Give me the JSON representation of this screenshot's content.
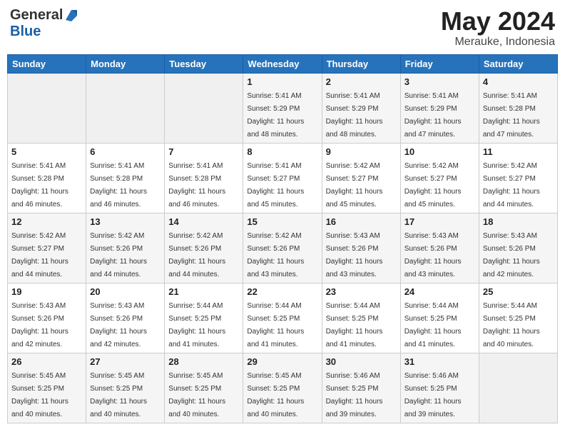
{
  "header": {
    "logo_general": "General",
    "logo_blue": "Blue",
    "month": "May 2024",
    "location": "Merauke, Indonesia"
  },
  "days_of_week": [
    "Sunday",
    "Monday",
    "Tuesday",
    "Wednesday",
    "Thursday",
    "Friday",
    "Saturday"
  ],
  "weeks": [
    [
      {
        "day": "",
        "info": ""
      },
      {
        "day": "",
        "info": ""
      },
      {
        "day": "",
        "info": ""
      },
      {
        "day": "1",
        "info": "Sunrise: 5:41 AM\nSunset: 5:29 PM\nDaylight: 11 hours\nand 48 minutes."
      },
      {
        "day": "2",
        "info": "Sunrise: 5:41 AM\nSunset: 5:29 PM\nDaylight: 11 hours\nand 48 minutes."
      },
      {
        "day": "3",
        "info": "Sunrise: 5:41 AM\nSunset: 5:29 PM\nDaylight: 11 hours\nand 47 minutes."
      },
      {
        "day": "4",
        "info": "Sunrise: 5:41 AM\nSunset: 5:28 PM\nDaylight: 11 hours\nand 47 minutes."
      }
    ],
    [
      {
        "day": "5",
        "info": "Sunrise: 5:41 AM\nSunset: 5:28 PM\nDaylight: 11 hours\nand 46 minutes."
      },
      {
        "day": "6",
        "info": "Sunrise: 5:41 AM\nSunset: 5:28 PM\nDaylight: 11 hours\nand 46 minutes."
      },
      {
        "day": "7",
        "info": "Sunrise: 5:41 AM\nSunset: 5:28 PM\nDaylight: 11 hours\nand 46 minutes."
      },
      {
        "day": "8",
        "info": "Sunrise: 5:41 AM\nSunset: 5:27 PM\nDaylight: 11 hours\nand 45 minutes."
      },
      {
        "day": "9",
        "info": "Sunrise: 5:42 AM\nSunset: 5:27 PM\nDaylight: 11 hours\nand 45 minutes."
      },
      {
        "day": "10",
        "info": "Sunrise: 5:42 AM\nSunset: 5:27 PM\nDaylight: 11 hours\nand 45 minutes."
      },
      {
        "day": "11",
        "info": "Sunrise: 5:42 AM\nSunset: 5:27 PM\nDaylight: 11 hours\nand 44 minutes."
      }
    ],
    [
      {
        "day": "12",
        "info": "Sunrise: 5:42 AM\nSunset: 5:27 PM\nDaylight: 11 hours\nand 44 minutes."
      },
      {
        "day": "13",
        "info": "Sunrise: 5:42 AM\nSunset: 5:26 PM\nDaylight: 11 hours\nand 44 minutes."
      },
      {
        "day": "14",
        "info": "Sunrise: 5:42 AM\nSunset: 5:26 PM\nDaylight: 11 hours\nand 44 minutes."
      },
      {
        "day": "15",
        "info": "Sunrise: 5:42 AM\nSunset: 5:26 PM\nDaylight: 11 hours\nand 43 minutes."
      },
      {
        "day": "16",
        "info": "Sunrise: 5:43 AM\nSunset: 5:26 PM\nDaylight: 11 hours\nand 43 minutes."
      },
      {
        "day": "17",
        "info": "Sunrise: 5:43 AM\nSunset: 5:26 PM\nDaylight: 11 hours\nand 43 minutes."
      },
      {
        "day": "18",
        "info": "Sunrise: 5:43 AM\nSunset: 5:26 PM\nDaylight: 11 hours\nand 42 minutes."
      }
    ],
    [
      {
        "day": "19",
        "info": "Sunrise: 5:43 AM\nSunset: 5:26 PM\nDaylight: 11 hours\nand 42 minutes."
      },
      {
        "day": "20",
        "info": "Sunrise: 5:43 AM\nSunset: 5:26 PM\nDaylight: 11 hours\nand 42 minutes."
      },
      {
        "day": "21",
        "info": "Sunrise: 5:44 AM\nSunset: 5:25 PM\nDaylight: 11 hours\nand 41 minutes."
      },
      {
        "day": "22",
        "info": "Sunrise: 5:44 AM\nSunset: 5:25 PM\nDaylight: 11 hours\nand 41 minutes."
      },
      {
        "day": "23",
        "info": "Sunrise: 5:44 AM\nSunset: 5:25 PM\nDaylight: 11 hours\nand 41 minutes."
      },
      {
        "day": "24",
        "info": "Sunrise: 5:44 AM\nSunset: 5:25 PM\nDaylight: 11 hours\nand 41 minutes."
      },
      {
        "day": "25",
        "info": "Sunrise: 5:44 AM\nSunset: 5:25 PM\nDaylight: 11 hours\nand 40 minutes."
      }
    ],
    [
      {
        "day": "26",
        "info": "Sunrise: 5:45 AM\nSunset: 5:25 PM\nDaylight: 11 hours\nand 40 minutes."
      },
      {
        "day": "27",
        "info": "Sunrise: 5:45 AM\nSunset: 5:25 PM\nDaylight: 11 hours\nand 40 minutes."
      },
      {
        "day": "28",
        "info": "Sunrise: 5:45 AM\nSunset: 5:25 PM\nDaylight: 11 hours\nand 40 minutes."
      },
      {
        "day": "29",
        "info": "Sunrise: 5:45 AM\nSunset: 5:25 PM\nDaylight: 11 hours\nand 40 minutes."
      },
      {
        "day": "30",
        "info": "Sunrise: 5:46 AM\nSunset: 5:25 PM\nDaylight: 11 hours\nand 39 minutes."
      },
      {
        "day": "31",
        "info": "Sunrise: 5:46 AM\nSunset: 5:25 PM\nDaylight: 11 hours\nand 39 minutes."
      },
      {
        "day": "",
        "info": ""
      }
    ]
  ]
}
